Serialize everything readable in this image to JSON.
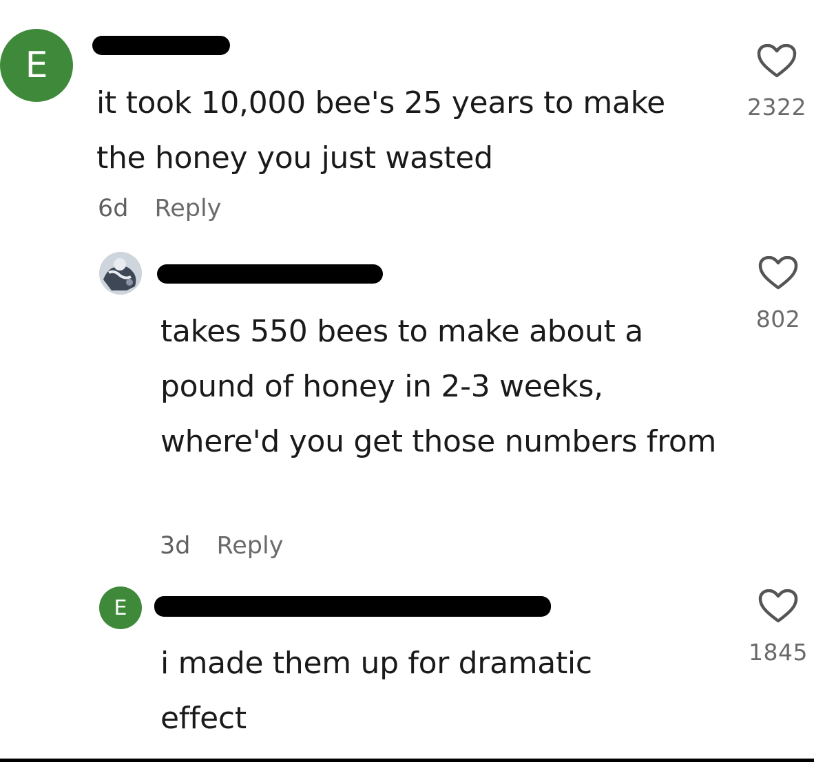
{
  "comments": [
    {
      "avatar_letter": "E",
      "text": "it took 10,000 bee's 25 years to make the honey you just wasted",
      "age": "6d",
      "reply_label": "Reply",
      "likes": "2322"
    },
    {
      "avatar_letter": "",
      "text": "takes 550 bees to make about a pound of honey in 2-3 weeks, where'd you get those numbers from",
      "age": "3d",
      "reply_label": "Reply",
      "likes": "802"
    },
    {
      "avatar_letter": "E",
      "text": "i made them up for dramatic effect",
      "age": "",
      "reply_label": "",
      "likes": "1845"
    }
  ],
  "colors": {
    "avatar_green": "#3f8a3a",
    "muted_text": "#6a6a6a",
    "redaction": "#000000"
  },
  "icons": {
    "like": "heart-outline-icon"
  }
}
